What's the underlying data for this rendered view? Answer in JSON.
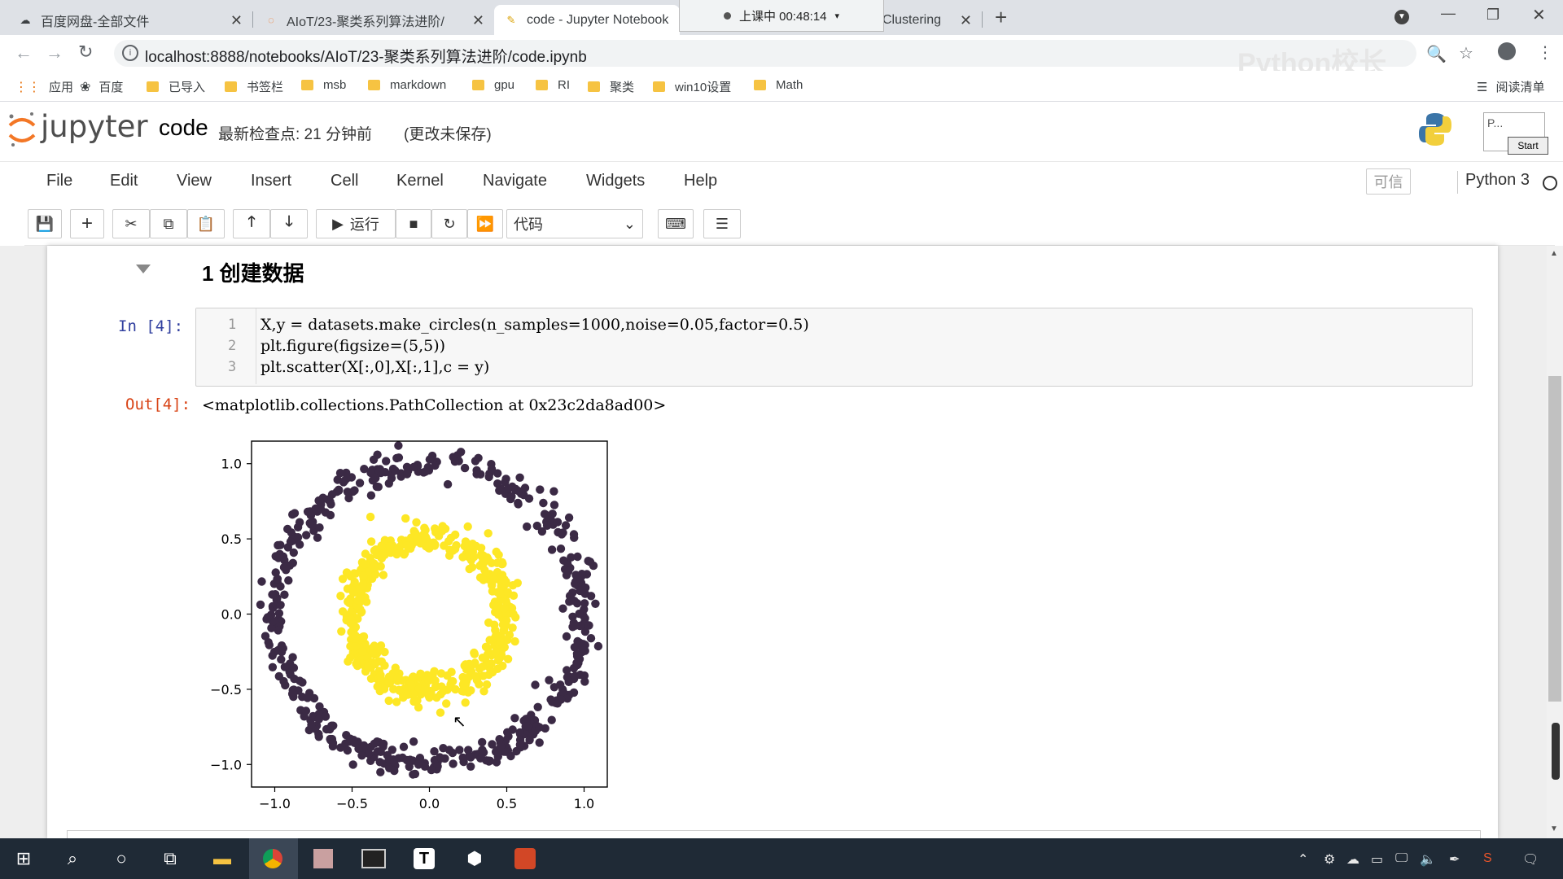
{
  "browser": {
    "tabs": [
      {
        "title": "百度网盘-全部文件",
        "active": false
      },
      {
        "title": "AIoT/23-聚类系列算法进阶/",
        "active": false
      },
      {
        "title": "code - Jupyter Notebook",
        "active": true
      },
      {
        "title": "Clustering",
        "active": false
      }
    ],
    "recording": "上课中 00:48:14",
    "url": "localhost:8888/notebooks/AIoT/23-聚类系列算法进阶/code.ipynb",
    "bookmarks": [
      "应用",
      "百度",
      "已导入",
      "书签栏",
      "msb",
      "markdown",
      "gpu",
      "RI",
      "聚类",
      "win10设置",
      "Math"
    ],
    "reading_list": "阅读清单",
    "watermark": "Python校长"
  },
  "jupyter": {
    "logo": "jupyter",
    "notebook_name": "code",
    "checkpoint": "最新检查点: 21 分钟前",
    "unsaved": "(更改未保存)",
    "menu": [
      "File",
      "Edit",
      "View",
      "Insert",
      "Cell",
      "Kernel",
      "Navigate",
      "Widgets",
      "Help"
    ],
    "trusted": "可信",
    "kernel": "Python 3",
    "toolbar": {
      "run_label": "运行",
      "cell_type": "代码"
    },
    "corner_popup": {
      "title": "P...",
      "button": "Start"
    }
  },
  "notebook": {
    "heading": "1  创建数据",
    "in_prompt": "In  [4]:",
    "code_lines": [
      {
        "n": "1",
        "text": "X,y = datasets.make_circles(n_samples=1000,noise=0.05,factor=0.5)"
      },
      {
        "n": "2",
        "text": "plt.figure(figsize=(5,5))"
      },
      {
        "n": "3",
        "text": "plt.scatter(X[:,0],X[:,1],c = y)"
      }
    ],
    "out_prompt": "Out[4]:",
    "out_text": "<matplotlib.collections.PathCollection at 0x23c2da8ad00>"
  },
  "chart_data": {
    "type": "scatter",
    "title": "",
    "xlabel": "",
    "ylabel": "",
    "xlim": [
      -1.15,
      1.15
    ],
    "ylim": [
      -1.15,
      1.15
    ],
    "x_ticks": [
      "−1.0",
      "−0.5",
      "0.0",
      "0.5",
      "1.0"
    ],
    "y_ticks": [
      "1.0",
      "0.5",
      "0.0",
      "−0.5",
      "−1.0"
    ],
    "x_tick_values": [
      -1.0,
      -0.5,
      0.0,
      0.5,
      1.0
    ],
    "y_tick_values": [
      1.0,
      0.5,
      0.0,
      -0.5,
      -1.0
    ],
    "grid": false,
    "series": [
      {
        "label_value": 0,
        "radius": 1.0,
        "noise": 0.05,
        "count": 500,
        "color": "#3b2a45"
      },
      {
        "label_value": 1,
        "radius": 0.5,
        "noise": 0.05,
        "count": 500,
        "color": "#fde725"
      }
    ]
  },
  "taskbar": {
    "icons": [
      "windows-start",
      "search",
      "cortana",
      "task-view",
      "file-explorer",
      "chrome",
      "app",
      "terminal",
      "typora",
      "app",
      "app"
    ]
  },
  "colors": {
    "jupyter_orange": "#f37726",
    "in_prompt": "#303f9f",
    "out_prompt": "#d84315",
    "taskbar": "#1f2a36"
  }
}
